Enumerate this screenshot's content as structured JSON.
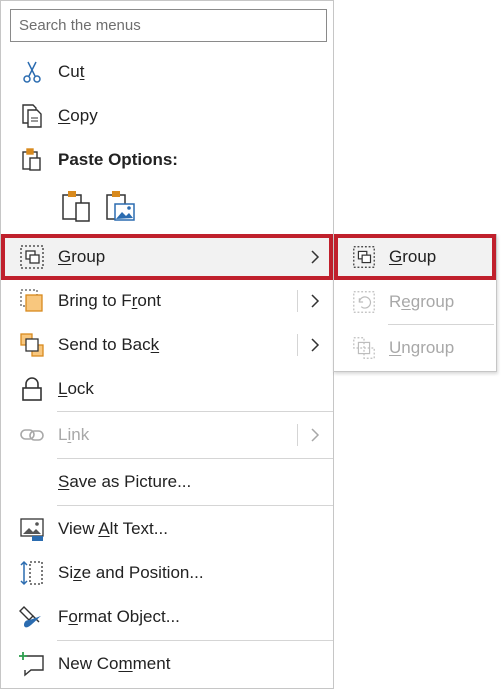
{
  "search": {
    "placeholder": "Search the menus"
  },
  "menu": {
    "cut": {
      "pre": "Cu",
      "key": "t",
      "post": ""
    },
    "copy": {
      "pre": "",
      "key": "C",
      "post": "opy"
    },
    "paste_options": {
      "label": "Paste Options:"
    },
    "group": {
      "pre": "",
      "key": "G",
      "post": "roup"
    },
    "bring_to_front": {
      "pre": "Bring to F",
      "key": "r",
      "post": "ont"
    },
    "send_to_back": {
      "pre": "Send to Bac",
      "key": "k",
      "post": ""
    },
    "lock": {
      "pre": "",
      "key": "L",
      "post": "ock"
    },
    "link": {
      "pre": "L",
      "key": "i",
      "post": "nk"
    },
    "save_as_picture": {
      "pre": "",
      "key": "S",
      "post": "ave as Picture..."
    },
    "view_alt_text": {
      "pre": "View ",
      "key": "A",
      "post": "lt Text..."
    },
    "size_and_position": {
      "pre": "Si",
      "key": "z",
      "post": "e and Position..."
    },
    "format_object": {
      "pre": "F",
      "key": "o",
      "post": "rmat Object..."
    },
    "new_comment": {
      "pre": "New Co",
      "key": "m",
      "post": "ment"
    }
  },
  "submenu": {
    "group": {
      "pre": "",
      "key": "G",
      "post": "roup"
    },
    "regroup": {
      "pre": "R",
      "key": "e",
      "post": "group"
    },
    "ungroup": {
      "pre": "",
      "key": "U",
      "post": "ngroup"
    }
  },
  "colors": {
    "highlight_border": "#c0202c",
    "icon_blue": "#2b6cb0",
    "icon_orange": "#d88a1e",
    "disabled": "#a8a8a8"
  }
}
